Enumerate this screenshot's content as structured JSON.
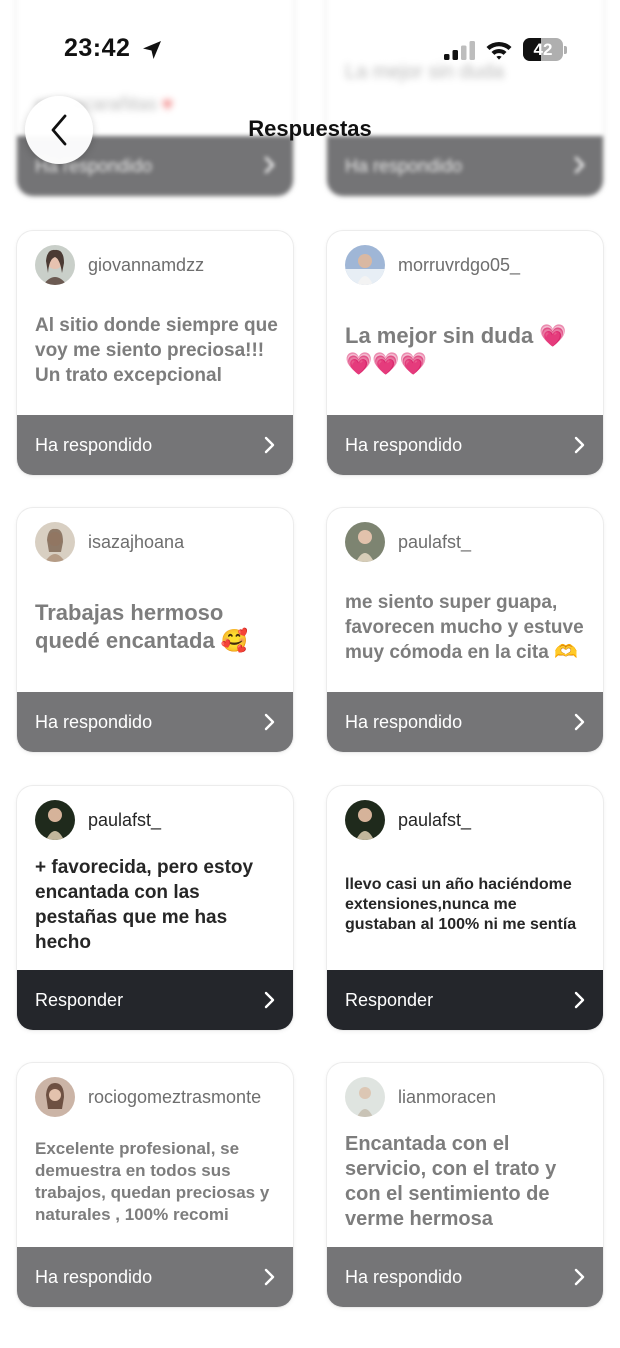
{
  "status_bar": {
    "time": "23:42",
    "battery": "42"
  },
  "header": {
    "title": "Respuestas"
  },
  "top_partial": {
    "left_lines": [
      "es macarañitas"
    ],
    "right_text": "La mejor sin duda",
    "left_button": "Ha respondido",
    "right_button": "Ha respondido"
  },
  "cards": [
    {
      "username": "giovannamdzz",
      "message": "Al sitio donde siempre que voy me siento preciosa!!! Un trato excepcional",
      "button": "Ha respondido"
    },
    {
      "username": "morruvrdgo05_",
      "message": "La mejor sin duda",
      "emoji": "💗💗💗💗",
      "button": "Ha respondido"
    },
    {
      "username": "isazajhoana",
      "message": "Trabajas hermoso quedé encantada",
      "emoji": "🥰",
      "button": "Ha respondido"
    },
    {
      "username": "paulafst_",
      "message": "me siento super guapa, favorecen mucho y estuve muy cómoda en la cita",
      "emoji": "🫶",
      "button": "Ha respondido"
    },
    {
      "username": "paulafst_",
      "message": "+ favorecida, pero estoy encantada con las pestañas que me has hecho",
      "button": "Responder"
    },
    {
      "username": "paulafst_",
      "message": "llevo casi un año haciéndome extensiones,nunca me gustaban al 100% ni me sentía",
      "button": "Responder"
    },
    {
      "username": "rociogomeztrasmonte",
      "message": "Excelente profesional, se demuestra en todos sus trabajos, quedan preciosas y naturales , 100% recomi",
      "button": "Ha respondido"
    },
    {
      "username": "lianmoracen",
      "message": "Encantada con el servicio, con el trato y con el sentimiento de verme hermosa",
      "button": "Ha respondido"
    }
  ],
  "colors": {
    "button_replied": "#757577",
    "button_reply": "#24262b",
    "text_muted": "#7d7d7d"
  }
}
